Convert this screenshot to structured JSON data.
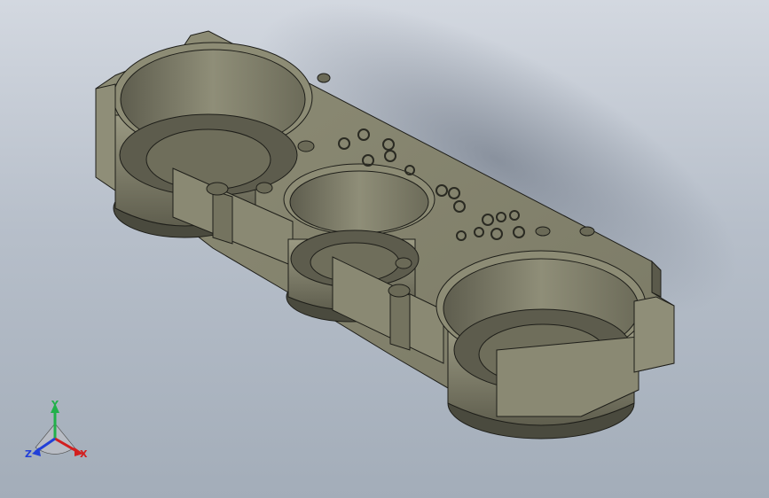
{
  "viewport": {
    "background_top": "#d3d8e0",
    "background_bottom": "#a3adb9"
  },
  "model": {
    "body_color": "#7b7a66",
    "body_shadow": "#4f4f42",
    "body_highlight": "#9a9982",
    "rim_dark": "#3e3e35"
  },
  "triad": {
    "x_label": "X",
    "y_label": "Y",
    "z_label": "Z",
    "x_color": "#d21f1f",
    "y_color": "#22b04a",
    "z_color": "#2240d8"
  }
}
